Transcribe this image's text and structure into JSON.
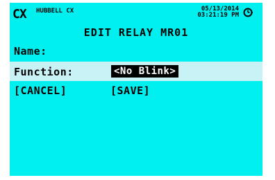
{
  "header": {
    "logo": "CX",
    "brand": "HUBBELL CX",
    "date": "05/13/2014",
    "time": "03:21:19 PM",
    "icon": "clock-icon"
  },
  "screen": {
    "title": "EDIT RELAY MR01",
    "name_label": "Name:",
    "name_value": "",
    "function_label": "Function:",
    "function_value": "<No Blink>",
    "cancel_label": "[CANCEL]",
    "save_label": "[SAVE]"
  },
  "colors": {
    "screen_bg": "#00f0f0",
    "highlight_row": "#c9f2f7",
    "selected_value_bg": "#000000",
    "selected_value_fg": "#ffffff"
  }
}
